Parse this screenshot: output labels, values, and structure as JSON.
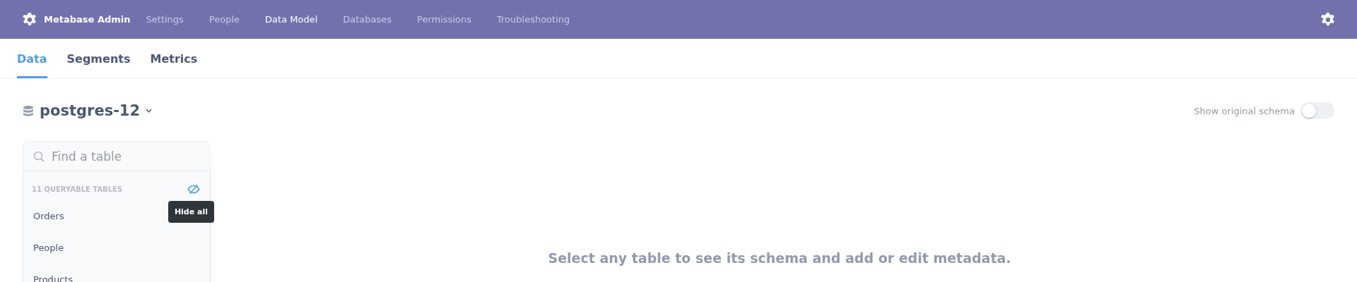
{
  "nav": {
    "brand": "Metabase Admin",
    "items": [
      {
        "label": "Settings",
        "selected": false
      },
      {
        "label": "People",
        "selected": false
      },
      {
        "label": "Data Model",
        "selected": true
      },
      {
        "label": "Databases",
        "selected": false
      },
      {
        "label": "Permissions",
        "selected": false
      },
      {
        "label": "Troubleshooting",
        "selected": false
      }
    ]
  },
  "tabs": [
    {
      "label": "Data",
      "selected": true
    },
    {
      "label": "Segments",
      "selected": false
    },
    {
      "label": "Metrics",
      "selected": false
    }
  ],
  "database": {
    "name": "postgres-12"
  },
  "schema_toggle": {
    "label": "Show original schema",
    "on": false
  },
  "sidebar": {
    "search": {
      "placeholder": "Find a table"
    },
    "heading": "11 QUERYABLE TABLES",
    "tooltip": "Hide all",
    "tables": [
      "Orders",
      "People",
      "Products"
    ]
  },
  "empty_message": "Select any table to see its schema and add or edit metadata."
}
